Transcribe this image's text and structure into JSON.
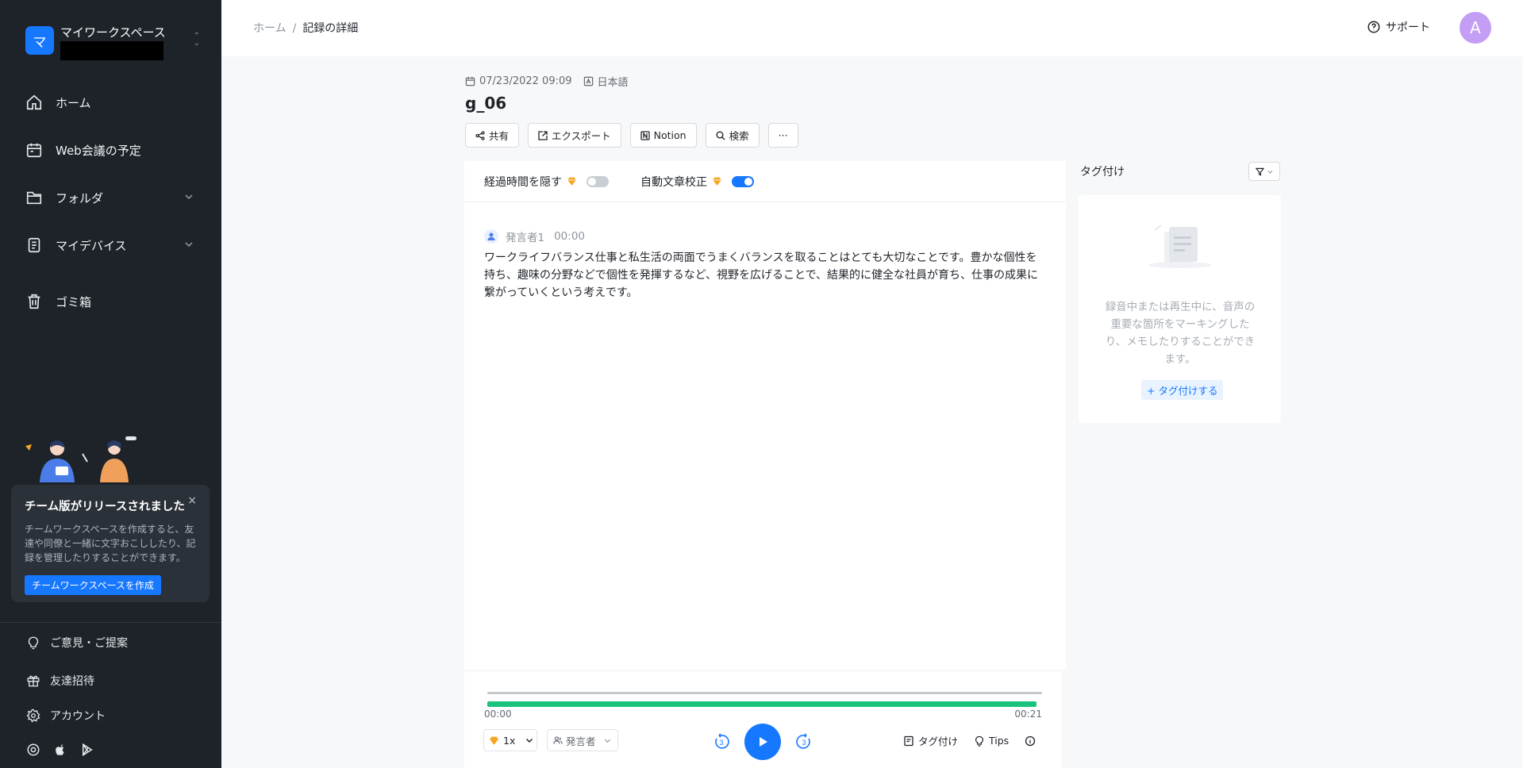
{
  "sidebar": {
    "workspace_initial": "マ",
    "workspace_name": "マイワークスペース",
    "nav": {
      "home": "ホーム",
      "meetings": "Web会議の予定",
      "folder": "フォルダ",
      "devices": "マイデバイス",
      "trash": "ゴミ箱"
    },
    "promo": {
      "title": "チーム版がリリースされました",
      "body": "チームワークスペースを作成すると、友達や同僚と一緒に文字おこししたり、記録を管理したりすることができます。",
      "button": "チームワークスペースを作成",
      "close": "×"
    },
    "bottom": {
      "feedback": "ご意見・ご提案",
      "invite": "友達招待",
      "account": "アカウント"
    }
  },
  "header": {
    "crumb_home": "ホーム",
    "crumb_sep": "/",
    "crumb_current": "記録の詳細",
    "support": "サポート",
    "avatar_initial": "A"
  },
  "record": {
    "datetime": "07/23/2022 09:09",
    "language": "日本語",
    "title": "g_06"
  },
  "toolbar": {
    "share": "共有",
    "export": "エクスポート",
    "notion": "Notion",
    "search": "検索",
    "more": "···"
  },
  "options": {
    "hide_time": "経過時間を隠す",
    "hide_time_on": false,
    "auto_correct": "自動文章校正",
    "auto_correct_on": true
  },
  "transcript": {
    "speaker": "発言者1",
    "time": "00:00",
    "text": "ワークライフバランス仕事と私生活の両面でうまくバランスを取ることはとても大切なことです。豊かな個性を持ち、趣味の分野などで個性を発揮するなど、視野を広げることで、結果的に健全な社員が育ち、仕事の成果に繋がっていくという考えです。"
  },
  "player": {
    "current": "00:00",
    "duration": "00:21",
    "progress": 0.99,
    "speed": "1x",
    "speaker_filter": "発言者",
    "skip_back": "3",
    "skip_fwd": "3",
    "tag": "タグ付け",
    "tips": "Tips"
  },
  "tags": {
    "title": "タグ付け",
    "empty_message": "録音中または再生中に、音声の重要な箇所をマーキングしたり、メモしたりすることができます。",
    "add": "+ タグ付けする"
  },
  "colors": {
    "accent": "#1677ff",
    "progress": "#19c37d",
    "sidebar": "#1e2329"
  }
}
